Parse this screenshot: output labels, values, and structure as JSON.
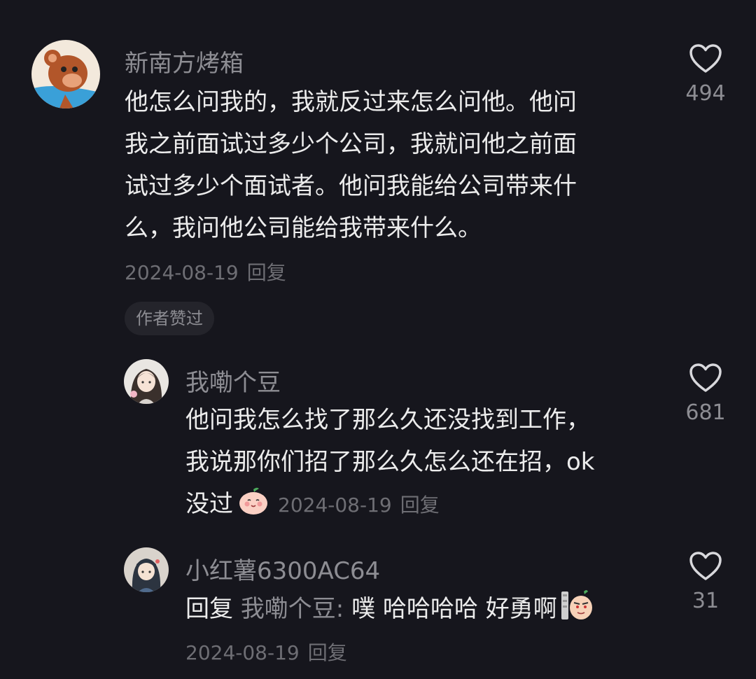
{
  "comments": [
    {
      "username": "新南方烤箱",
      "lines": [
        "他怎么问我的，我就反过来怎么问他。他问",
        "我之前面试过多少个公司，我就问他之前面",
        "试过多少个面试者。他问我能给公司带来什",
        "么，我问他公司能给我带来什么。"
      ],
      "date": "2024-08-19",
      "reply_label": "回复",
      "likes": "494",
      "badge": "作者赞过"
    },
    {
      "username": "我嘞个豆",
      "lines": [
        "他问我怎么找了那么久还没找到工作，",
        "我说那你们招了那么久怎么还在招，ok",
        "没过"
      ],
      "date": "2024-08-19",
      "reply_label": "回复",
      "likes": "681"
    },
    {
      "username": "小红薯6300AC64",
      "reply_prefix": "回复",
      "mention": "我嘞个豆:",
      "text": "噗 哈哈哈哈 好勇啊",
      "date": "2024-08-19",
      "reply_label": "回复",
      "likes": "31"
    }
  ],
  "icons": {
    "like": "heart-outline-icon",
    "emoji_1": "smiling-peach-emoji",
    "emoji_2": "sly-face-emoji"
  },
  "colors": {
    "background": "#16161d",
    "text": "#ececec",
    "secondary": "#8d8d93",
    "meta": "#6e6e74"
  }
}
